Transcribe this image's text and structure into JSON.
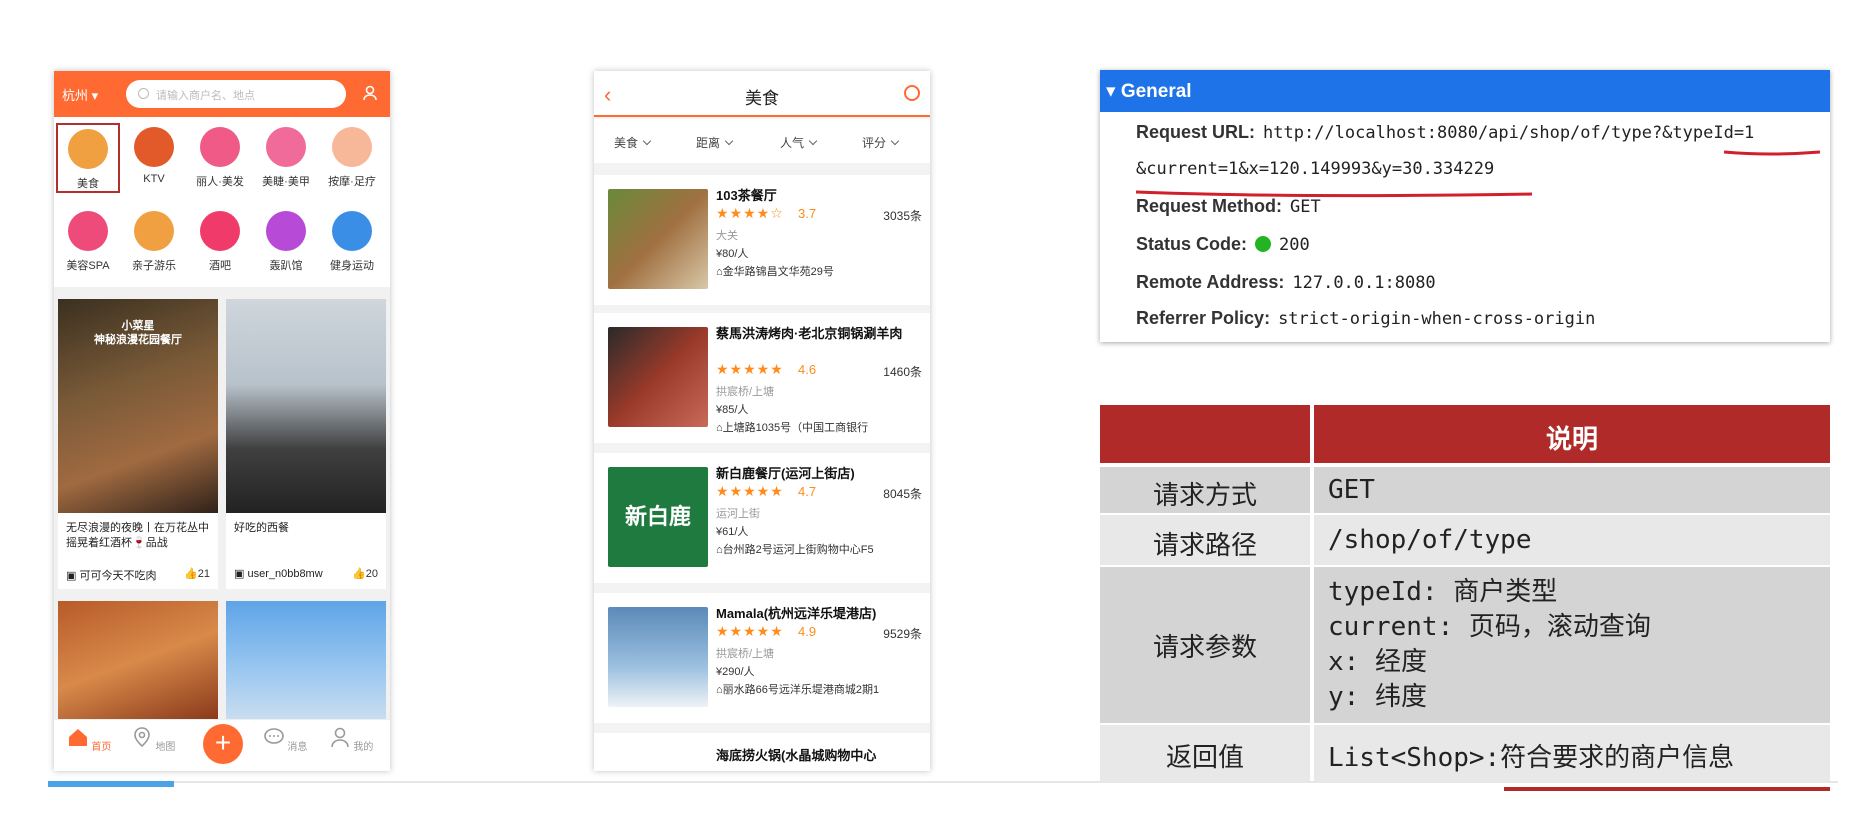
{
  "phone1": {
    "city": "杭州",
    "search_placeholder": "请输入商户名、地点",
    "categories": [
      {
        "label": "美食",
        "color": "#f0a040"
      },
      {
        "label": "KTV",
        "color": "#e25a2a"
      },
      {
        "label": "丽人·美发",
        "color": "#ef5a86"
      },
      {
        "label": "美睫·美甲",
        "color": "#f06a9a"
      },
      {
        "label": "按摩·足疗",
        "color": "#f7b89a"
      },
      {
        "label": "美容SPA",
        "color": "#ee4a7a"
      },
      {
        "label": "亲子游乐",
        "color": "#f0a040"
      },
      {
        "label": "酒吧",
        "color": "#f03a6a"
      },
      {
        "label": "轰趴馆",
        "color": "#b84ad8"
      },
      {
        "label": "健身运动",
        "color": "#3a8ee6"
      }
    ],
    "tiles": [
      {
        "title": "无尽浪漫的夜晚丨在万花丛中摇晃着红酒杯🍷品战",
        "overlay": "小菜星\n神秘浪漫花园餐厅",
        "author": "可可今天不吃肉",
        "likes": "21"
      },
      {
        "title": "好吃的西餐",
        "author": "user_n0bb8mw",
        "likes": "20"
      }
    ],
    "tabs": [
      "首页",
      "地图",
      "消息",
      "我的"
    ]
  },
  "phone2": {
    "title": "美食",
    "filters": [
      "美食",
      "距离",
      "人气",
      "评分"
    ],
    "shops": [
      {
        "name": "103茶餐厅",
        "stars": "★★★★☆",
        "score": "3.7",
        "comments": "3035条",
        "area": "大关",
        "price": "¥80/人",
        "address": "金华路锦昌文华苑29号",
        "img": "#8a6a3a"
      },
      {
        "name": "蔡馬洪涛烤肉·老北京铜锅涮羊肉",
        "stars": "★★★★★",
        "score": "4.6",
        "comments": "1460条",
        "area": "拱宸桥/上塘",
        "price": "¥85/人",
        "address": "上塘路1035号（中国工商银行",
        "img": "#9a3a2a"
      },
      {
        "name": "新白鹿餐厅(运河上街店)",
        "stars": "★★★★★",
        "score": "4.7",
        "comments": "8045条",
        "area": "运河上街",
        "price": "¥61/人",
        "address": "台州路2号运河上街购物中心F5",
        "img": "#1f7a40",
        "logo": "新白鹿"
      },
      {
        "name": "Mamala(杭州远洋乐堤港店)",
        "stars": "★★★★★",
        "score": "4.9",
        "comments": "9529条",
        "area": "拱宸桥/上塘",
        "price": "¥290/人",
        "address": "丽水路66号远洋乐堤港商城2期1",
        "img": "#5a8ab8"
      },
      {
        "name": "海底捞火锅(水晶城购物中心"
      }
    ]
  },
  "general": {
    "header": "General",
    "request_url_label": "Request URL:",
    "request_url_line1": "http://localhost:8080/api/shop/of/type?&typeId=1",
    "request_url_line2": "&current=1&x=120.149993&y=30.334229",
    "request_method_label": "Request Method:",
    "request_method": "GET",
    "status_code_label": "Status Code:",
    "status_code": "200",
    "remote_address_label": "Remote Address:",
    "remote_address": "127.0.0.1:8080",
    "referrer_policy_label": "Referrer Policy:",
    "referrer_policy": "strict-origin-when-cross-origin"
  },
  "spec": {
    "header_right": "说明",
    "rows": [
      {
        "key": "请求方式",
        "value": "GET"
      },
      {
        "key": "请求路径",
        "value": "/shop/of/type"
      },
      {
        "key": "请求参数",
        "value_lines": [
          "typeId: 商户类型",
          "current: 页码，滚动查询",
          "x: 经度",
          "y: 纬度"
        ]
      },
      {
        "key": "返回值",
        "value": "List<Shop>:符合要求的商户信息"
      }
    ]
  },
  "colors": {
    "orange": "#ff6a33",
    "general_blue": "#1e73e8",
    "table_red": "#b02a2a",
    "underline_red": "#d0202a"
  }
}
